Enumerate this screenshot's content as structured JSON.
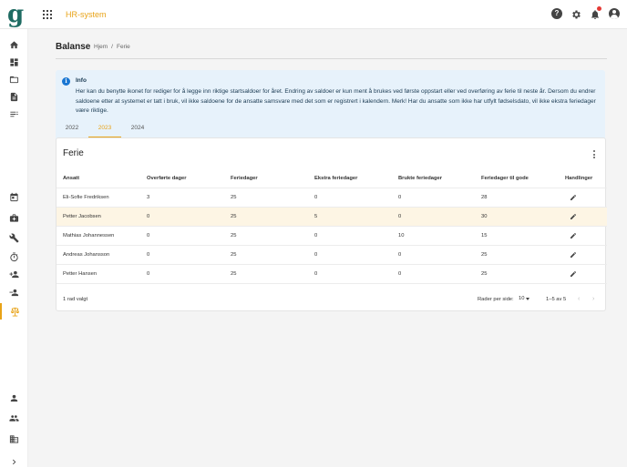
{
  "app": {
    "logo_letter": "g",
    "title": "HR-system"
  },
  "page": {
    "title": "Balanse",
    "breadcrumb": [
      "Hjem",
      "Ferie"
    ]
  },
  "info": {
    "title": "Info",
    "text": "Her kan du benytte ikonet for rediger for å legge inn riktige startsaldoer for året. Endring av saldoer er kun ment å brukes ved første oppstart eller ved overføring av ferie til neste år. Dersom du endrer saldoene etter at systemet er tatt i bruk, vil ikke saldoene for de ansatte samsvare med det som er registrert i kalendern. Merk! Har du ansatte som ikke har utfylt fødselsdato, vil ikke ekstra feriedager være riktige."
  },
  "tabs": [
    {
      "label": "2022",
      "active": false
    },
    {
      "label": "2023",
      "active": true
    },
    {
      "label": "2024",
      "active": false
    }
  ],
  "card": {
    "title": "Ferie"
  },
  "table": {
    "columns": [
      "Ansatt",
      "Overførte dager",
      "Feriedager",
      "Ekstra feriedager",
      "Brukte feriedager",
      "Feriedager til gode",
      "Handlinger"
    ],
    "rows": [
      {
        "name": "Eli-Sofie Fredriksen",
        "overforte": "3",
        "feriedager": "25",
        "ekstra": "0",
        "brukte": "0",
        "tilgode": "28",
        "selected": false
      },
      {
        "name": "Petter Jacobsen",
        "overforte": "0",
        "feriedager": "25",
        "ekstra": "5",
        "brukte": "0",
        "tilgode": "30",
        "selected": true
      },
      {
        "name": "Mathias Johannessen",
        "overforte": "0",
        "feriedager": "25",
        "ekstra": "0",
        "brukte": "10",
        "tilgode": "15",
        "selected": false
      },
      {
        "name": "Andreas Johansson",
        "overforte": "0",
        "feriedager": "25",
        "ekstra": "0",
        "brukte": "0",
        "tilgode": "25",
        "selected": false
      },
      {
        "name": "Petter Hansen",
        "overforte": "0",
        "feriedager": "25",
        "ekstra": "0",
        "brukte": "0",
        "tilgode": "25",
        "selected": false
      }
    ]
  },
  "footer": {
    "selected_text": "1 rad valgt",
    "rows_per_page_label": "Rader per side:",
    "rows_per_page_value": "10",
    "page_range": "1–5 av 5"
  },
  "icons": {
    "topbar": [
      "apps-icon",
      "help-icon",
      "settings-icon",
      "notifications-icon",
      "account-icon"
    ],
    "sidebar": [
      "home-icon",
      "dashboard-icon",
      "folder-icon",
      "document-icon",
      "list-icon",
      "calendar-icon",
      "briefcase-icon",
      "tools-icon",
      "timer-icon",
      "person-add-icon",
      "person-remove-icon",
      "balance-scale-icon",
      "person-icon",
      "group-icon",
      "business-icon",
      "chevron-right-icon"
    ]
  },
  "colors": {
    "accent": "#e8a317",
    "brand": "#1e6b62",
    "info_bg": "#e7f2fb",
    "info_icon": "#1976d2",
    "selected_row": "#fdf5e4"
  }
}
